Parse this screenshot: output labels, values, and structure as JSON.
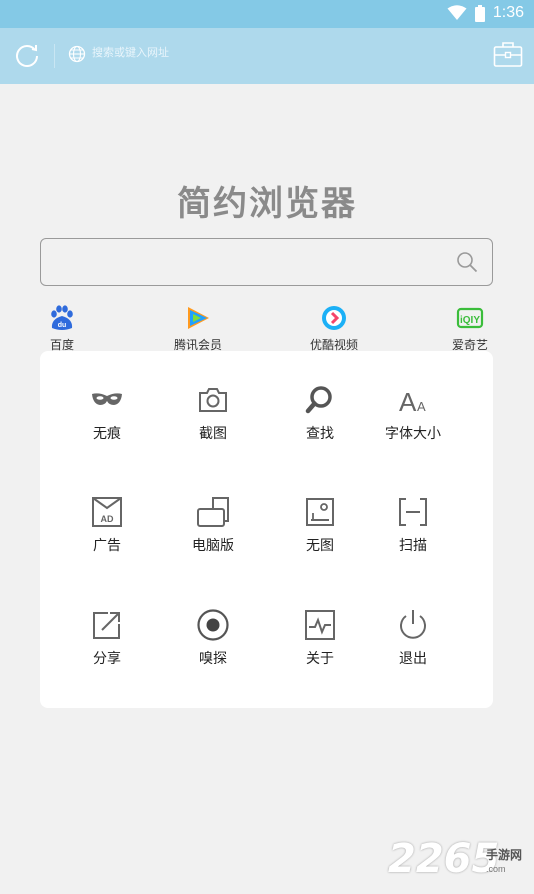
{
  "status_bar": {
    "time": "1:36",
    "icons": [
      "wifi-icon",
      "battery-icon"
    ]
  },
  "toolbar": {
    "url_placeholder": "搜索或键入网址"
  },
  "app_title": "简约浏览器",
  "search": {
    "value": "",
    "placeholder": ""
  },
  "shortcuts": [
    {
      "label": "百度",
      "icon": "baidu-icon",
      "color": "#2f6bdc"
    },
    {
      "label": "腾讯会员",
      "icon": "tencent-video-icon",
      "color": "#20a0ff"
    },
    {
      "label": "优酷视频",
      "icon": "youku-icon",
      "color": "#1cb0f6"
    },
    {
      "label": "爱奇艺",
      "icon": "iqiyi-icon",
      "color": "#3bbd3b"
    }
  ],
  "menu": [
    {
      "label": "无痕",
      "icon": "mask-icon"
    },
    {
      "label": "截图",
      "icon": "camera-icon"
    },
    {
      "label": "查找",
      "icon": "search-icon"
    },
    {
      "label": "字体大小",
      "icon": "font-size-icon"
    },
    {
      "label": "广告",
      "icon": "ad-icon"
    },
    {
      "label": "电脑版",
      "icon": "desktop-icon"
    },
    {
      "label": "无图",
      "icon": "no-image-icon"
    },
    {
      "label": "扫描",
      "icon": "scan-icon"
    },
    {
      "label": "分享",
      "icon": "share-icon"
    },
    {
      "label": "嗅探",
      "icon": "sniff-icon"
    },
    {
      "label": "关于",
      "icon": "about-icon"
    },
    {
      "label": "退出",
      "icon": "power-icon"
    }
  ],
  "watermark": {
    "number": "2265",
    "site_cn": "手游网",
    "site_url": ".com"
  },
  "colors": {
    "status_bar": "#84c9e6",
    "toolbar": "#aed9ec",
    "background": "#f1f1f1",
    "icon_gray": "#666666"
  }
}
